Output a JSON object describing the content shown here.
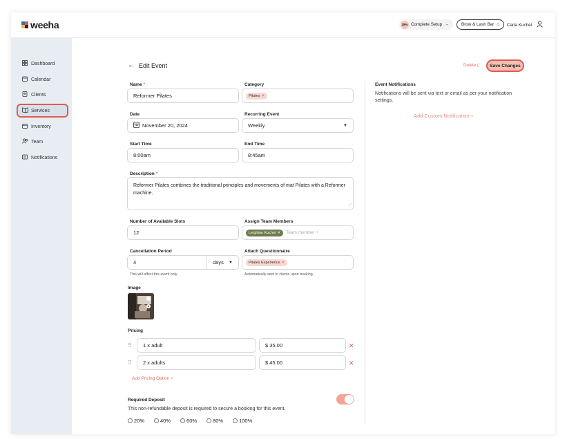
{
  "brand": {
    "name": "weeha"
  },
  "topbar": {
    "setup_pct": "28%",
    "setup_label": "Complete Setup",
    "business_label": "Brow & Lash Bar",
    "user_name": "Carla Kuchel"
  },
  "sidebar": {
    "items": [
      {
        "label": "Dashboard",
        "icon": "grid-icon"
      },
      {
        "label": "Calendar",
        "icon": "calendar-icon"
      },
      {
        "label": "Clients",
        "icon": "contact-icon"
      },
      {
        "label": "Services",
        "icon": "book-icon"
      },
      {
        "label": "Inventory",
        "icon": "box-icon"
      },
      {
        "label": "Team",
        "icon": "team-icon"
      },
      {
        "label": "Notifications",
        "icon": "notification-icon"
      }
    ],
    "active": "Services"
  },
  "header": {
    "title": "Edit Event",
    "delete_label": "Delete",
    "save_label": "Save Changes"
  },
  "form": {
    "name_label": "Name",
    "name_value": "Reformer Pilates",
    "category_label": "Category",
    "category_chip": "Pilates",
    "date_label": "Date",
    "date_value": "November 20, 2024",
    "recurring_label": "Recurring Event",
    "recurring_value": "Weekly",
    "start_label": "Start Time",
    "start_value": "8:00am",
    "end_label": "End Time",
    "end_value": "8:45am",
    "description_label": "Description",
    "description_value": "Reformer Pilates combines the traditional principles and movements of mat Pilates with a Reformer machine.",
    "slots_label": "Number of Available Slots",
    "slots_value": "12",
    "team_label": "Assign Team Members",
    "team_chip": "Leighton Kuchel",
    "team_placeholder": "Team member +",
    "cancel_label": "Cancellation Period",
    "cancel_value": "4",
    "cancel_unit": "days",
    "cancel_help": "This will affect this event only.",
    "questionnaire_label": "Attach Questionnaire",
    "questionnaire_chip": "Pilates Experience",
    "questionnaire_help": "Automatically sent to clients upon booking.",
    "image_label": "Image",
    "pricing_label": "Pricing",
    "pricing": [
      {
        "option": "1 x adult",
        "price": "$ 35.00"
      },
      {
        "option": "2 x adults",
        "price": "$ 45.00"
      }
    ],
    "add_pricing": "Add Pricing Option +",
    "deposit_label": "Required Deposit",
    "deposit_text": "This non-refundable deposit is required to secure a booking for this event.",
    "deposit_enabled": true,
    "deposit_options": [
      "20%",
      "40%",
      "60%",
      "80%",
      "100%"
    ]
  },
  "notifications": {
    "title": "Event Notifications",
    "text": "Notifications will be sent via text or email as per your notification settings.",
    "add_label": "Add Custom Notification +"
  },
  "colors": {
    "accent": "#e05a55",
    "accent_light": "#f5bfb4",
    "sidebar_bg": "#e7edf2",
    "chip_green": "#6d7b4d"
  }
}
